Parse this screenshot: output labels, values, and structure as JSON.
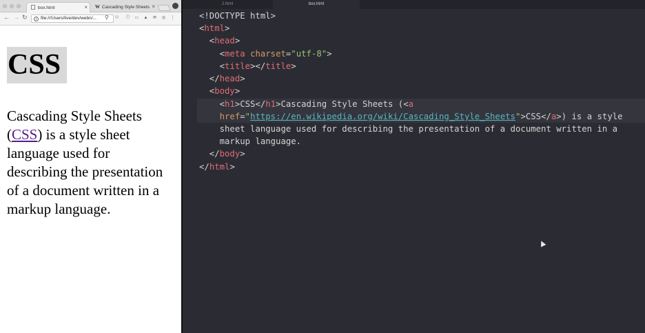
{
  "browser": {
    "tabs": [
      {
        "title": "box.html",
        "active": true
      },
      {
        "title": "Cascading Style Sheets",
        "active": false
      }
    ],
    "address": "file:///Users/live/dev/webn/..."
  },
  "page": {
    "heading": "CSS",
    "para_prefix": "Cascading Style Sheets (",
    "link_text": "CSS",
    "para_suffix": ") is a style sheet language used for describing the presentation of a document written in a markup language."
  },
  "editor": {
    "tabs": [
      {
        "title": "2.html",
        "active": false
      },
      {
        "title": "box.html",
        "active": true
      }
    ],
    "lines": {
      "doctype": "<!DOCTYPE html>",
      "html_open": "html",
      "head_open": "head",
      "meta_tag": "meta",
      "meta_attr": "charset",
      "meta_val": "\"utf-8\"",
      "title_tag": "title",
      "head_close": "head",
      "body_open": "body",
      "h1_tag": "h1",
      "h1_text": "CSS",
      "after_h1": "Cascading Style Sheets (",
      "a_tag": "a",
      "href_attr": "href",
      "href_url": "https://en.wikipedia.org/wiki/Cascading_Style_Sheets",
      "link_text": "CSS",
      "after_a": ") is a style",
      "line8": "sheet language used for describing the presentation of a document written in a",
      "line9": "markup language.",
      "body_close": "body",
      "html_close": "html"
    }
  },
  "colors": {
    "tag": "#e06c75",
    "attribute": "#d19a66",
    "string": "#98c379",
    "url": "#56b6c2",
    "editor_bg": "#2b2c33",
    "link_visited": "#551a8b"
  }
}
